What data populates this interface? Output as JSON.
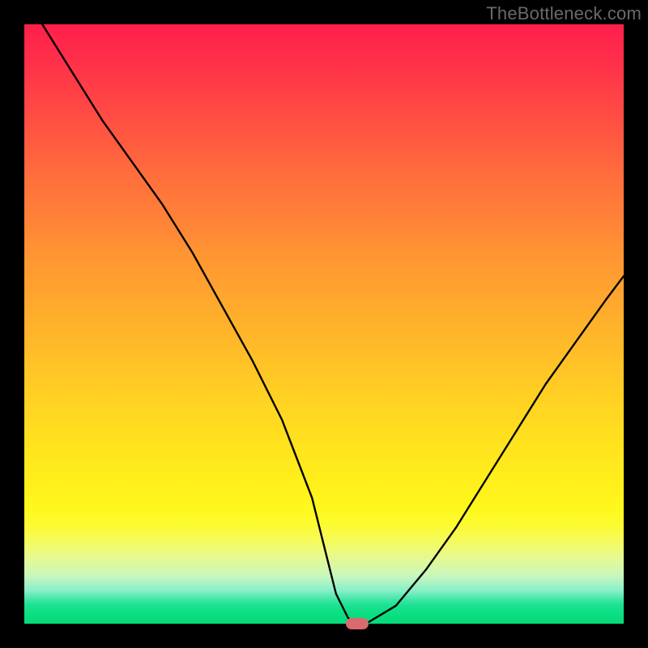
{
  "watermark": "TheBottleneck.com",
  "colors": {
    "curve": "#000000",
    "marker": "#d96a6e",
    "frame": "#000000"
  },
  "chart_data": {
    "type": "line",
    "title": "",
    "xlabel": "",
    "ylabel": "",
    "xlim": [
      0,
      100
    ],
    "ylim": [
      0,
      100
    ],
    "grid": false,
    "legend": false,
    "series": [
      {
        "name": "bottleneck-curve",
        "x": [
          3,
          8,
          13,
          18,
          23,
          28,
          33,
          38,
          43,
          48,
          50,
          52,
          54,
          55,
          57,
          62,
          67,
          72,
          77,
          82,
          87,
          92,
          97,
          100
        ],
        "y": [
          100,
          92,
          84,
          77,
          70,
          62,
          53,
          44,
          34,
          21,
          13,
          5,
          1,
          0,
          0,
          3,
          9,
          16,
          24,
          32,
          40,
          47,
          54,
          58
        ]
      }
    ],
    "marker": {
      "x": 55.5,
      "y": 0
    },
    "background_gradient": {
      "top": "#ff1f4b",
      "mid": "#ffd522",
      "bottom": "#05dc7b"
    }
  }
}
